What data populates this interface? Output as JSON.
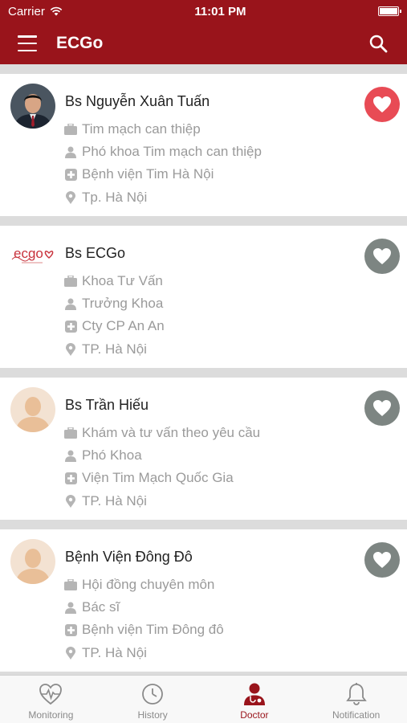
{
  "status_bar": {
    "carrier": "Carrier",
    "time": "11:01 PM"
  },
  "header": {
    "title": "ECGo"
  },
  "doctors": [
    {
      "name": "Bs Nguyễn Xuân Tuấn",
      "specialty": "Tim mạch can thiệp",
      "position": "Phó khoa Tim mạch can thiệp",
      "hospital": "Bệnh viện Tim Hà Nội",
      "location": "Tp. Hà Nội",
      "favorite": true
    },
    {
      "name": "Bs ECGo",
      "specialty": "Khoa Tư Vấn",
      "position": "Trưởng Khoa",
      "hospital": "Cty CP An An",
      "location": "TP. Hà Nội",
      "favorite": false,
      "logo_text": "ecgo"
    },
    {
      "name": "Bs Trần Hiếu",
      "specialty": "Khám và tư vấn theo yêu cầu",
      "position": "Phó Khoa",
      "hospital": "Viện Tim Mạch Quốc Gia",
      "location": "TP. Hà Nội",
      "favorite": false
    },
    {
      "name": "Bệnh Viện Đông Đô",
      "specialty": "Hội đồng chuyên môn",
      "position": "Bác sĩ",
      "hospital": "Bệnh viện Tim Đông đô",
      "location": "TP. Hà Nội",
      "favorite": false
    }
  ],
  "tabs": [
    {
      "label": "Monitoring",
      "icon": "heart-monitor-icon"
    },
    {
      "label": "History",
      "icon": "clock-icon"
    },
    {
      "label": "Doctor",
      "icon": "doctor-icon",
      "active": true
    },
    {
      "label": "Notification",
      "icon": "bell-icon"
    }
  ],
  "colors": {
    "primary": "#99141b",
    "favorite_on": "#e84b55",
    "favorite_off": "#7d8582",
    "info_text": "#9a9a9a"
  }
}
